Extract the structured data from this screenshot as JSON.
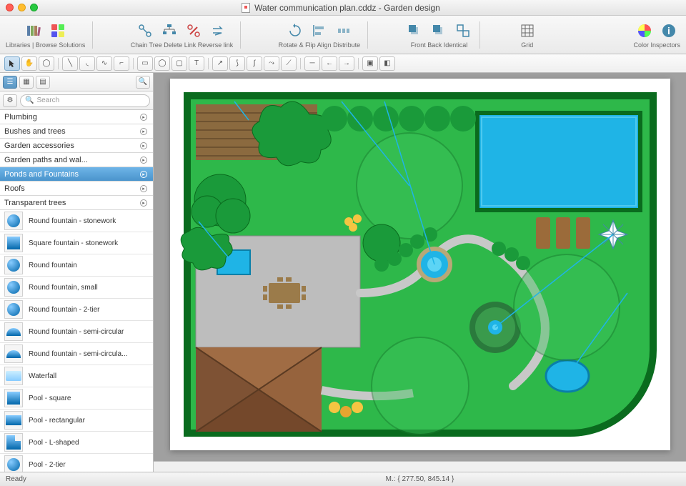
{
  "window": {
    "title": "Water communication plan.cddz - Garden design"
  },
  "toolbar": {
    "groups": [
      {
        "label": "Libraries | Browse Solutions",
        "icons": [
          "libraries",
          "solutions"
        ]
      },
      {
        "label": "Chain    Tree    Delete Link    Reverse link",
        "icons": [
          "chain",
          "tree",
          "delete-link",
          "reverse-link"
        ]
      },
      {
        "label": "Rotate & Flip    Align    Distribute",
        "icons": [
          "rotate",
          "align",
          "distribute"
        ]
      },
      {
        "label": "Front    Back    Identical",
        "icons": [
          "front",
          "back",
          "identical"
        ]
      },
      {
        "label": "Grid",
        "icons": [
          "grid"
        ]
      },
      {
        "label": "Color  Inspectors",
        "icons": [
          "color",
          "inspectors"
        ]
      }
    ]
  },
  "search": {
    "placeholder": "Search"
  },
  "categories": [
    {
      "label": "Plumbing",
      "selected": false
    },
    {
      "label": "Bushes and trees",
      "selected": false
    },
    {
      "label": "Garden accessories",
      "selected": false
    },
    {
      "label": "Garden paths and wal...",
      "selected": false
    },
    {
      "label": "Ponds and Fountains",
      "selected": true
    },
    {
      "label": "Roofs",
      "selected": false
    },
    {
      "label": "Transparent trees",
      "selected": false
    }
  ],
  "stencils": [
    {
      "label": "Round fountain - stonework",
      "thumb": "circle-blue"
    },
    {
      "label": "Square fountain - stonework",
      "thumb": "square-blue"
    },
    {
      "label": "Round fountain",
      "thumb": "circle-blue"
    },
    {
      "label": "Round fountain, small",
      "thumb": "circle-blue"
    },
    {
      "label": "Round fountain - 2-tier",
      "thumb": "circle-blue"
    },
    {
      "label": "Round fountain - semi-circular",
      "thumb": "semi-blue"
    },
    {
      "label": "Round fountain - semi-circula...",
      "thumb": "semi-blue"
    },
    {
      "label": "Waterfall",
      "thumb": "wave"
    },
    {
      "label": "Pool - square",
      "thumb": "square-blue"
    },
    {
      "label": "Pool - rectangular",
      "thumb": "rect-blue"
    },
    {
      "label": "Pool - L-shaped",
      "thumb": "lshape"
    },
    {
      "label": "Pool - 2-tier",
      "thumb": "circle-blue"
    }
  ],
  "status": {
    "ready": "Ready",
    "coords": "M.: { 277.50, 845.14 }"
  }
}
